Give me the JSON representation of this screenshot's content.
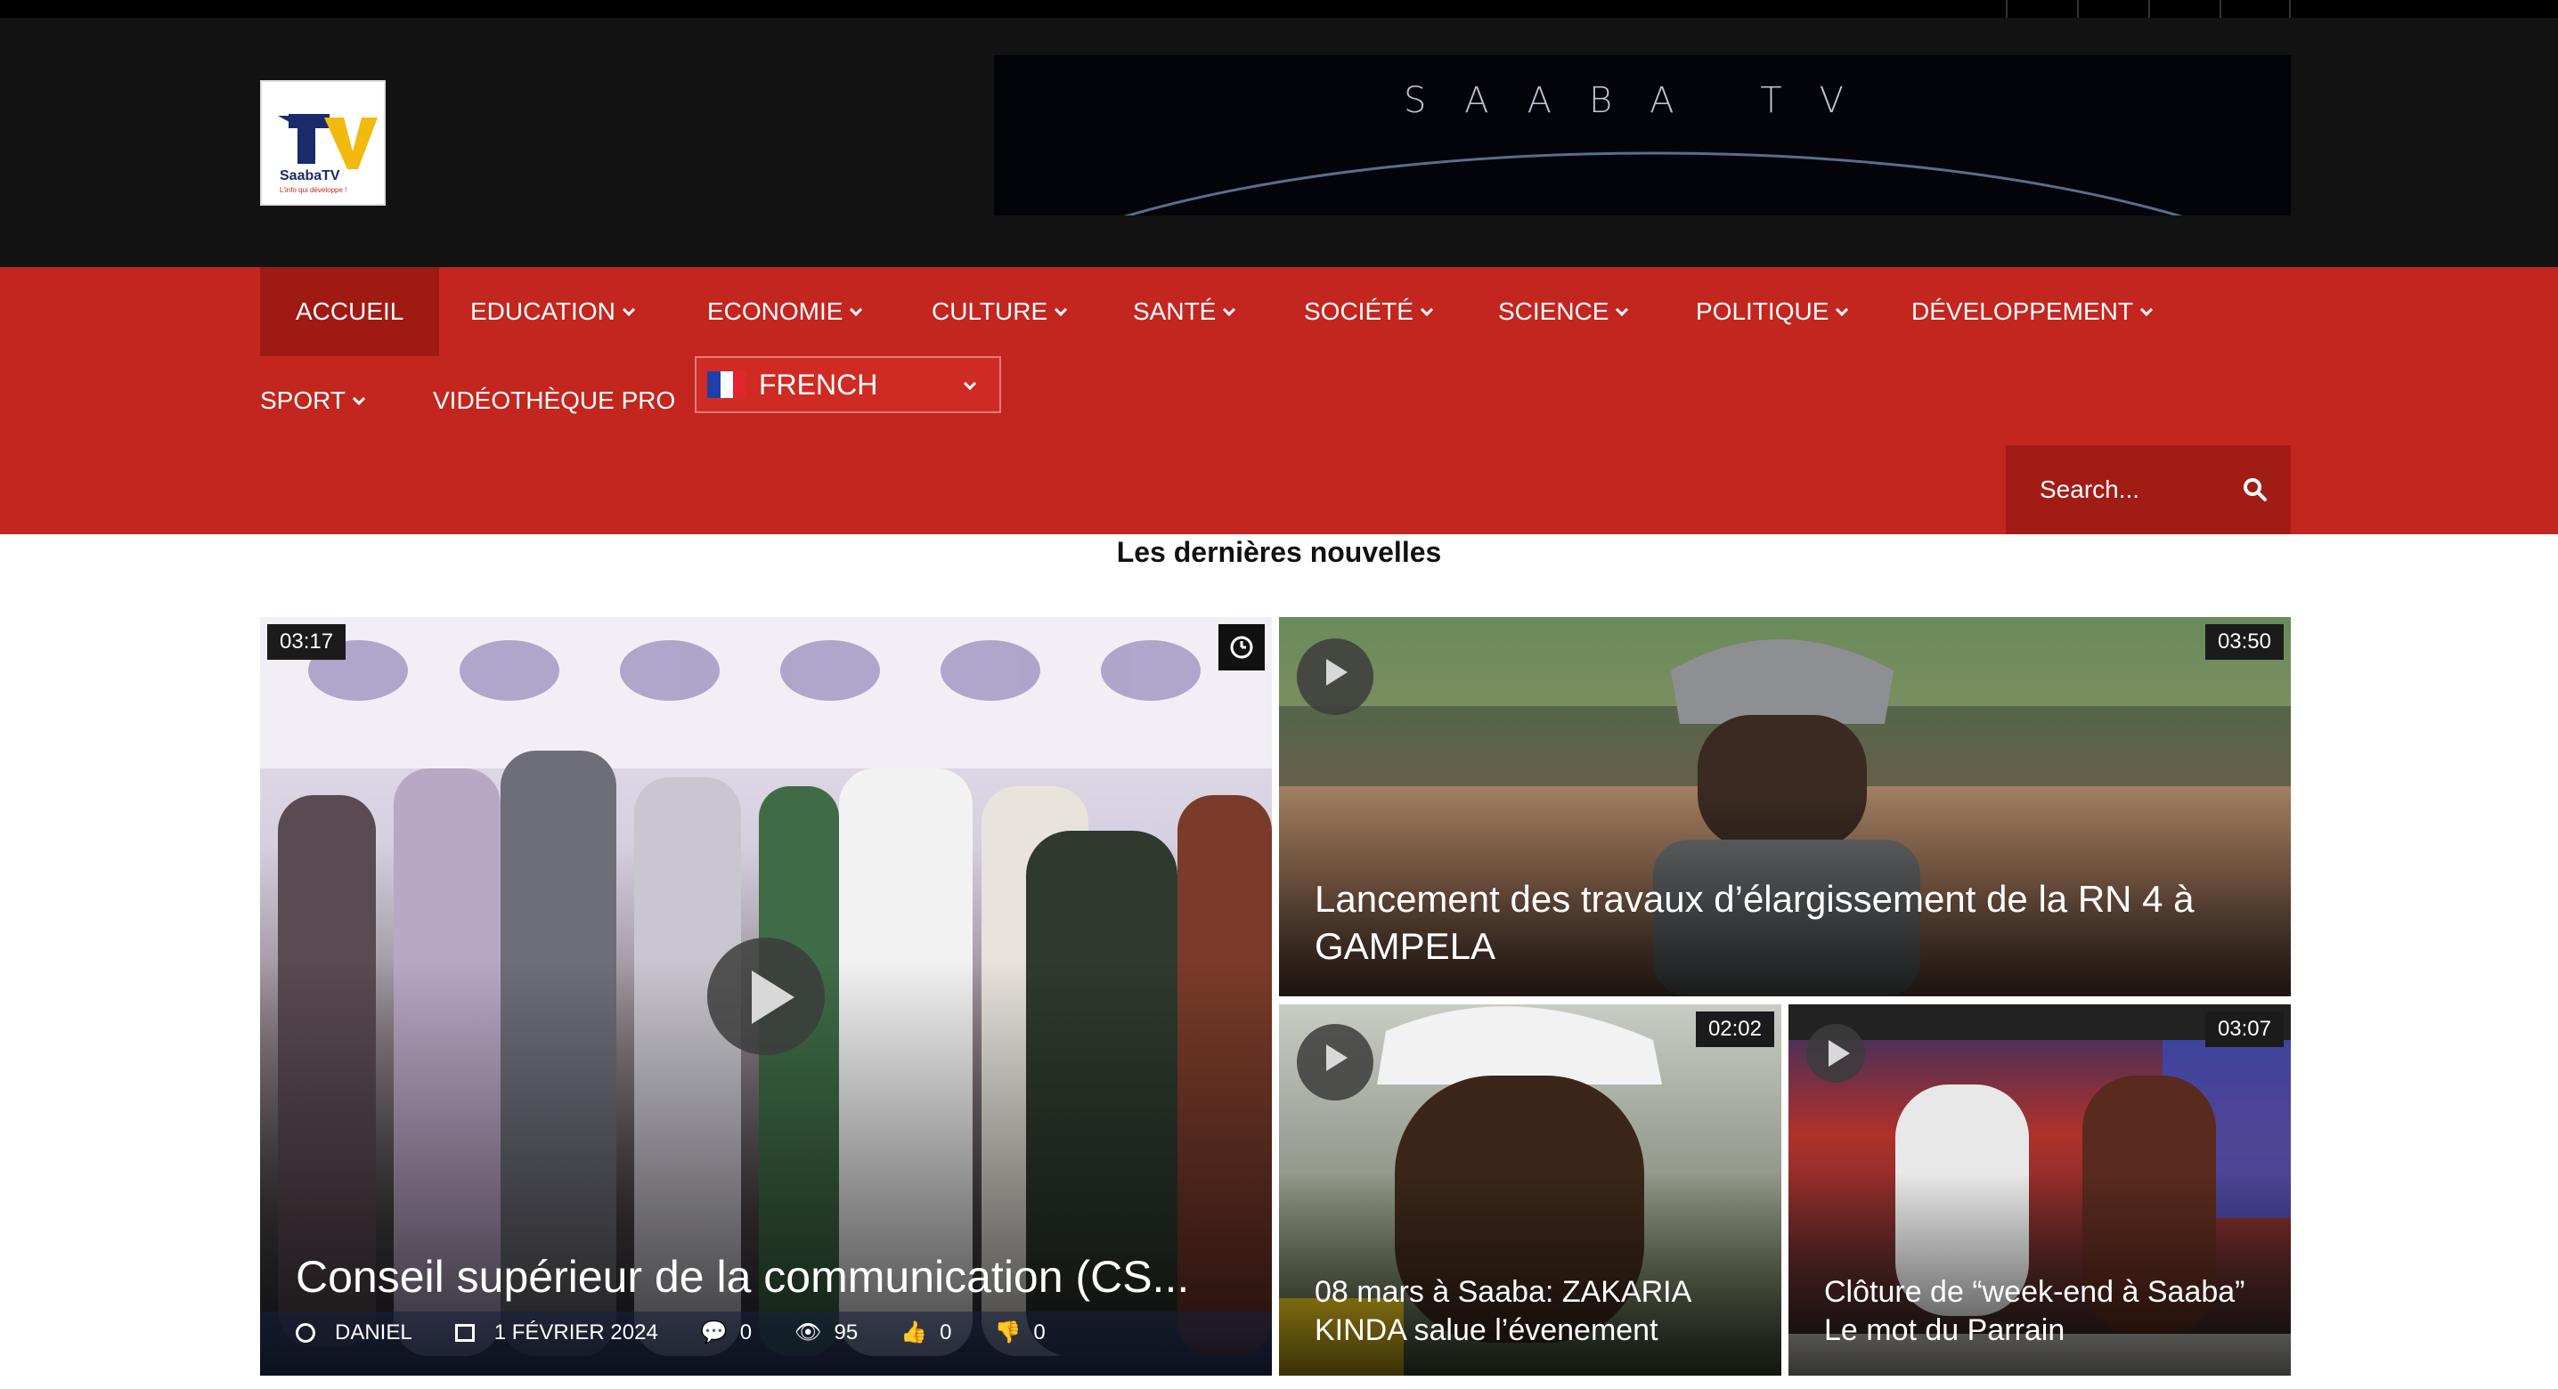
{
  "header": {
    "logo_text": "SaabaTV",
    "logo_tagline": "L'info qui développe !",
    "banner_text": "SAABA TV"
  },
  "nav": {
    "items": [
      {
        "label": "ACCUEIL",
        "dropdown": false,
        "active": true
      },
      {
        "label": "EDUCATION",
        "dropdown": true
      },
      {
        "label": "ECONOMIE",
        "dropdown": true
      },
      {
        "label": "CULTURE",
        "dropdown": true
      },
      {
        "label": "SANTÉ",
        "dropdown": true
      },
      {
        "label": "SOCIÉTÉ",
        "dropdown": true
      },
      {
        "label": "SCIENCE",
        "dropdown": true
      },
      {
        "label": "POLITIQUE",
        "dropdown": true
      },
      {
        "label": "DÉVELOPPEMENT",
        "dropdown": true
      },
      {
        "label": "SPORT",
        "dropdown": true
      },
      {
        "label": "VIDÉOTHÈQUE PRO",
        "dropdown": false
      }
    ],
    "language": "FRENCH",
    "search_placeholder": "Search..."
  },
  "main": {
    "section_title": "Les dernières nouvelles",
    "featured": {
      "duration": "03:17",
      "title": "Conseil supérieur de la communication (CS...",
      "author": "DANIEL",
      "date": "1 FÉVRIER 2024",
      "comments": "0",
      "views": "95",
      "likes": "0",
      "dislikes": "0"
    },
    "cards": [
      {
        "duration": "03:50",
        "title": "Lancement des travaux d’élargissement de la RN 4 à GAMPELA"
      },
      {
        "duration": "02:02",
        "title": "08 mars à Saaba: ZAKARIA KINDA salue l’évenement"
      },
      {
        "duration": "03:07",
        "title": "Clôture de “week-end à Saaba” Le mot du Parrain"
      }
    ]
  },
  "colors": {
    "nav_red": "#c3261f",
    "nav_active": "#a01a14",
    "header_dark": "#121212"
  }
}
